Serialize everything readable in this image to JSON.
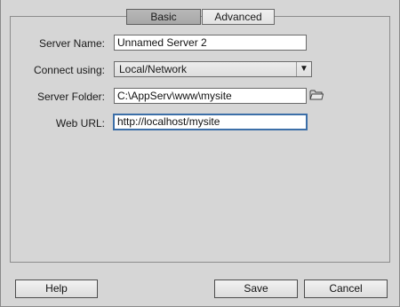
{
  "tabs": [
    {
      "label": "Basic",
      "active": true
    },
    {
      "label": "Advanced",
      "active": false
    }
  ],
  "form": {
    "server_name": {
      "label": "Server Name:",
      "value": "Unnamed Server 2"
    },
    "connect_using": {
      "label": "Connect using:",
      "value": "Local/Network"
    },
    "server_folder": {
      "label": "Server Folder:",
      "value": "C:\\AppServ\\www\\mysite"
    },
    "web_url": {
      "label": "Web URL:",
      "value": "http://localhost/mysite"
    }
  },
  "buttons": {
    "help": "Help",
    "save": "Save",
    "cancel": "Cancel"
  },
  "icons": {
    "dropdown": "chevron-down-icon",
    "folder": "folder-icon"
  },
  "colors": {
    "background": "#d6d6d6",
    "focus_border": "#3c6fa8"
  }
}
